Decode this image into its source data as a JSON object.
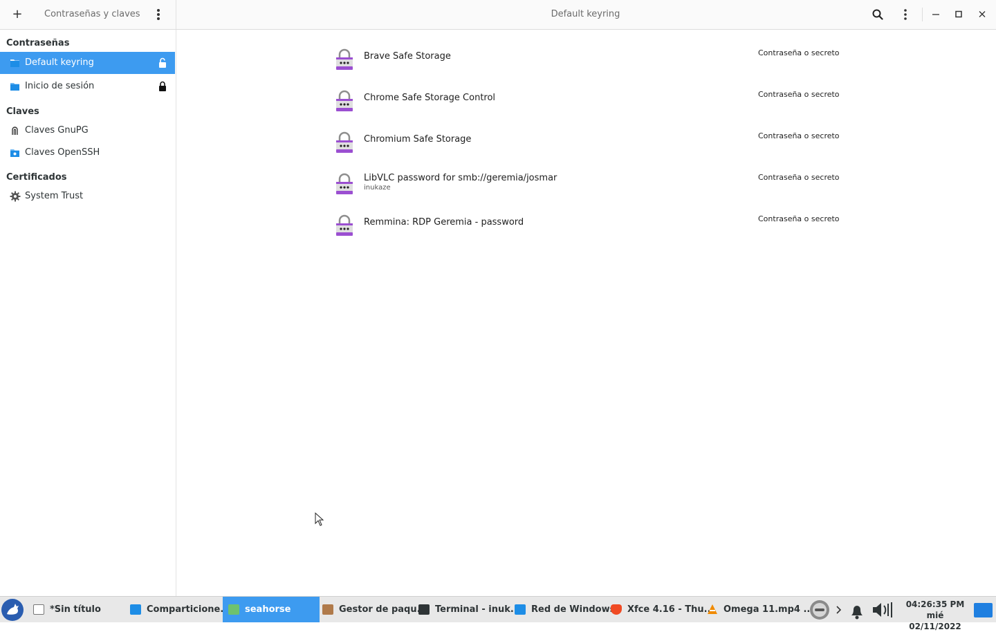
{
  "header": {
    "add_label": "+",
    "app_title": "Contraseñas y claves",
    "keyring_title": "Default keyring"
  },
  "sidebar": {
    "sections": [
      {
        "title": "Contraseñas"
      },
      {
        "title": "Claves"
      },
      {
        "title": "Certificados"
      }
    ],
    "items": [
      {
        "label": "Default keyring",
        "icon": "folder-icon",
        "lock": "unlocked"
      },
      {
        "label": "Inicio de sesión",
        "icon": "folder-icon",
        "lock": "locked"
      },
      {
        "label": "Claves GnuPG",
        "icon": "gnupg-icon"
      },
      {
        "label": "Claves OpenSSH",
        "icon": "ssh-folder-icon"
      },
      {
        "label": "System Trust",
        "icon": "gear-icon"
      }
    ]
  },
  "entries": [
    {
      "name": "Brave Safe Storage",
      "sub": "",
      "kind": "Contraseña o secreto"
    },
    {
      "name": "Chrome Safe Storage Control",
      "sub": "",
      "kind": "Contraseña o secreto"
    },
    {
      "name": "Chromium Safe Storage",
      "sub": "",
      "kind": "Contraseña o secreto"
    },
    {
      "name": "LibVLC password for smb://geremia/josmar",
      "sub": "inukaze",
      "kind": "Contraseña o secreto"
    },
    {
      "name": "Remmina: RDP Geremia - password",
      "sub": "",
      "kind": "Contraseña o secreto"
    }
  ],
  "taskbar": {
    "tasks": [
      {
        "label": "*Sin título",
        "icon": "text-editor-icon"
      },
      {
        "label": "Comparticione...",
        "icon": "sharing-icon"
      },
      {
        "label": "seahorse",
        "icon": "seahorse-icon"
      },
      {
        "label": "Gestor de paqu...",
        "icon": "package-manager-icon"
      },
      {
        "label": "Terminal - inuk...",
        "icon": "terminal-icon"
      },
      {
        "label": "Red de Windows",
        "icon": "network-folder-icon"
      },
      {
        "label": "Xfce 4.16 - Thu...",
        "icon": "brave-browser-icon"
      },
      {
        "label": "Omega 11.mp4 ...",
        "icon": "vlc-icon"
      }
    ],
    "clock_time": "04:26:35 PM",
    "clock_date": "mié 02/11/2022"
  },
  "colors": {
    "accent": "#3d9bf0",
    "lock_purple": "#9b4fd1"
  }
}
